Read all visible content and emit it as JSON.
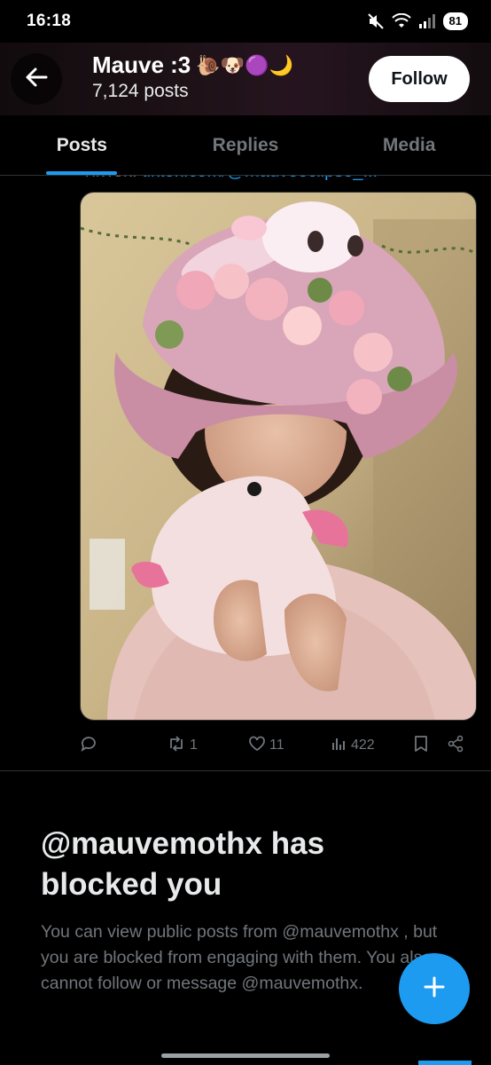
{
  "status_bar": {
    "time": "16:18",
    "battery": "81",
    "icons": [
      "mute-icon",
      "wifi-icon",
      "signal-icon",
      "battery-icon"
    ]
  },
  "header": {
    "name": "Mauve :3",
    "name_emojis": "🐌🐶🟣🌙",
    "post_count": "7,124 posts",
    "follow_label": "Follow",
    "back_icon": "arrow-left-icon"
  },
  "tabs": [
    {
      "label": "Posts",
      "active": true
    },
    {
      "label": "Replies",
      "active": false
    },
    {
      "label": "Media",
      "active": false
    }
  ],
  "post": {
    "partial_text_prefix": "TikTok: ",
    "partial_text_link": "tiktok.com/@mauveeclipse_...",
    "actions": {
      "reply_count": "",
      "repost_count": "1",
      "like_count": "11",
      "view_count": "422"
    }
  },
  "blocked_notice": {
    "title": "@mauvemothx has blocked you",
    "description": "You can view public posts from @mauvemothx , but you are blocked from engaging with them. You also cannot follow or message @mauvemothx."
  },
  "fab": {
    "icon": "plus-icon"
  },
  "colors": {
    "accent": "#1d9bf0",
    "background": "#000000",
    "secondary_text": "#71767b",
    "primary_text": "#e7e9ea"
  }
}
